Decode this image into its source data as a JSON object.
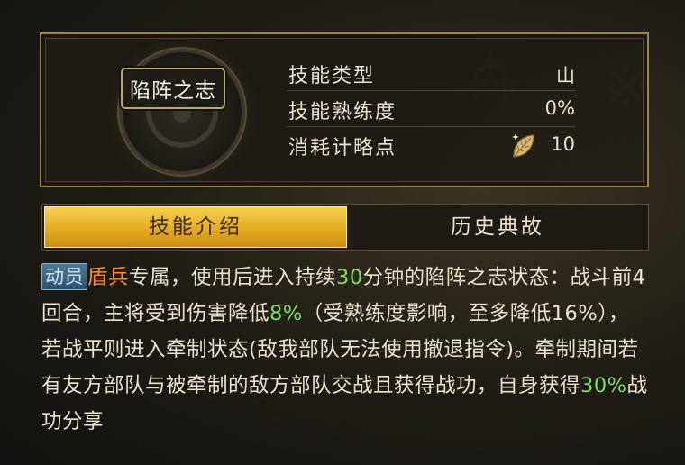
{
  "skill": {
    "name": "陷阵之志",
    "rows": [
      {
        "label": "技能类型",
        "value": "山"
      },
      {
        "label": "技能熟练度",
        "value": "0%"
      },
      {
        "label": "消耗计略点",
        "value": "10",
        "icon": "golden-leaf-icon"
      }
    ]
  },
  "tabs": [
    {
      "label": "技能介绍",
      "active": true
    },
    {
      "label": "历史典故",
      "active": false
    }
  ],
  "description": {
    "badge": "动员",
    "segments": [
      {
        "text": "盾兵",
        "color": "#ff8a2b"
      },
      {
        "text": "专属，使用后进入持续"
      },
      {
        "text": "30",
        "color": "#7dde65"
      },
      {
        "text": "分钟的陷阵之志状态：战斗前4回合，主将受到伤害降低"
      },
      {
        "text": "8%",
        "color": "#7dde65"
      },
      {
        "text": "（受熟练度影响，至多降低16%），若战平则进入牵制状态(敌我部队无法使用撤退指令)。牵制期间若有友方部队与被牵制的敌方部队交战且获得战功，自身获得"
      },
      {
        "text": "30%",
        "color": "#7dde65"
      },
      {
        "text": "战功分享"
      }
    ]
  },
  "colors": {
    "accent_gold": "#e4ac21",
    "highlight_orange": "#ff8a2b",
    "highlight_green": "#7dde65",
    "badge_blue": "#2c5270"
  }
}
